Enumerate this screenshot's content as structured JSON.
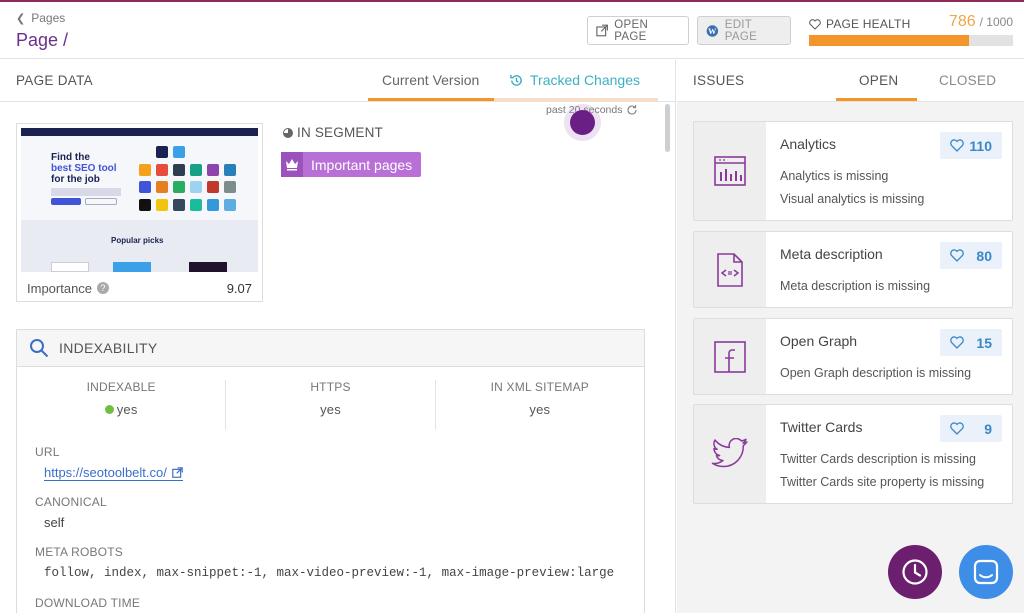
{
  "header": {
    "back_label": "Pages",
    "page_title": "Page /",
    "open_page_label": "OPEN PAGE",
    "edit_page_label": "EDIT PAGE",
    "health_label": "PAGE HEALTH",
    "health_score": "786",
    "health_max": "/ 1000",
    "health_fraction": 0.786
  },
  "left": {
    "section_title": "PAGE DATA",
    "tabs": [
      {
        "label": "Current Version"
      },
      {
        "label": "Tracked Changes"
      }
    ],
    "updated_text": "past 20 seconds",
    "screenshot": {
      "headline_1": "Find the",
      "headline_2": "best SEO tool",
      "headline_3": "for the job",
      "popular": "Popular picks"
    },
    "importance_label": "Importance",
    "importance_value": "9.07",
    "segment_label": "IN SEGMENT",
    "segment_tag": "Important pages",
    "indexability": {
      "title": "INDEXABILITY",
      "columns": [
        {
          "label": "INDEXABLE",
          "value": "yes"
        },
        {
          "label": "HTTPS",
          "value": "yes"
        },
        {
          "label": "IN XML SITEMAP",
          "value": "yes"
        }
      ],
      "url_label": "URL",
      "url_value": "https://seotoolbelt.co/",
      "canonical_label": "CANONICAL",
      "canonical_value": "self",
      "meta_robots_label": "META ROBOTS",
      "meta_robots_value": "follow, index, max-snippet:-1, max-video-preview:-1, max-image-preview:large",
      "download_label": "DOWNLOAD TIME"
    }
  },
  "issues": {
    "title": "ISSUES",
    "tab_open": "OPEN",
    "tab_closed": "CLOSED",
    "cards": [
      {
        "title": "Analytics",
        "count": "110",
        "lines": [
          "Analytics is missing",
          "Visual analytics is missing"
        ],
        "icon": "analytics-icon"
      },
      {
        "title": "Meta description",
        "count": "80",
        "lines": [
          "Meta description is missing"
        ],
        "icon": "code-document-icon"
      },
      {
        "title": "Open Graph",
        "count": "15",
        "lines": [
          "Open Graph description is missing"
        ],
        "icon": "facebook-icon"
      },
      {
        "title": "Twitter Cards",
        "count": "9",
        "lines": [
          "Twitter Cards description is missing",
          "Twitter Cards site property is missing"
        ],
        "icon": "twitter-icon"
      }
    ]
  },
  "colors": {
    "accent_purple": "#6b2f8e",
    "health_orange": "#f4952c",
    "tracked_teal": "#3cb0c2",
    "count_blue": "#3a87c8"
  }
}
